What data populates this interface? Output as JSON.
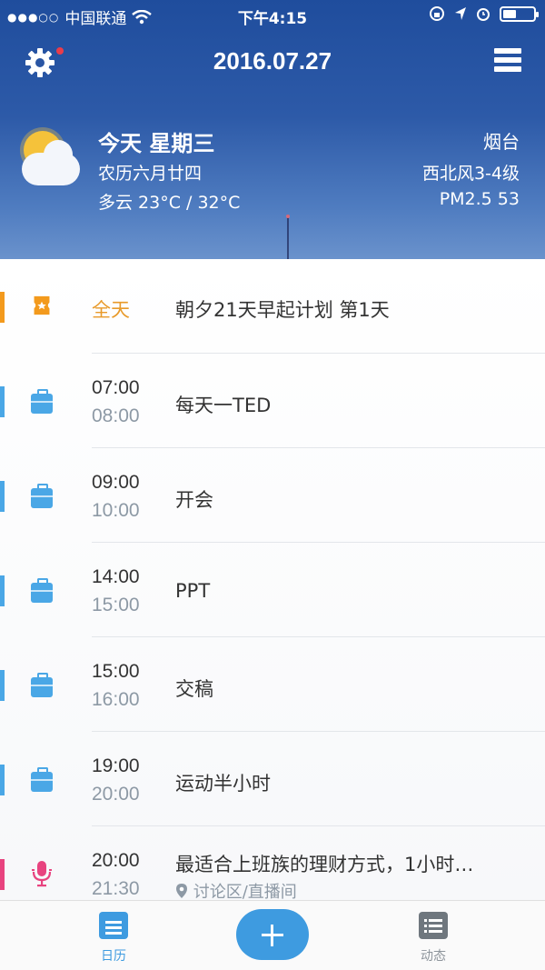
{
  "status_bar": {
    "carrier": "中国联通",
    "time": "下午4:15"
  },
  "header": {
    "date": "2016.07.27"
  },
  "weather": {
    "day": "今天 星期三",
    "lunar": "农历六月廿四",
    "condition_temp": "多云 23°C / 32°C",
    "city": "烟台",
    "wind": "西北风3-4级",
    "pm25": "PM2.5 53",
    "icon": "partly-cloudy-icon"
  },
  "events": [
    {
      "kind": "all-day",
      "all_day_label": "全天",
      "title": "朝夕21天早起计划 第1天",
      "color": "#f39a1d",
      "icon": "ticket-icon"
    },
    {
      "start": "07:00",
      "end": "08:00",
      "title": "每天一TED",
      "color": "#4aa7e6",
      "icon": "briefcase-icon"
    },
    {
      "start": "09:00",
      "end": "10:00",
      "title": "开会",
      "color": "#4aa7e6",
      "icon": "briefcase-icon"
    },
    {
      "start": "14:00",
      "end": "15:00",
      "title": "PPT",
      "color": "#4aa7e6",
      "icon": "briefcase-icon"
    },
    {
      "start": "15:00",
      "end": "16:00",
      "title": "交稿",
      "color": "#4aa7e6",
      "icon": "briefcase-icon"
    },
    {
      "start": "19:00",
      "end": "20:00",
      "title": "运动半小时",
      "color": "#4aa7e6",
      "icon": "briefcase-icon"
    },
    {
      "start": "20:00",
      "end": "21:30",
      "title": "最适合上班族的理财方式，1小时…",
      "location": "讨论区/直播间",
      "color": "#e8437f",
      "icon": "microphone-icon"
    }
  ],
  "tabbar": {
    "calendar_label": "日历",
    "feed_label": "动态"
  }
}
